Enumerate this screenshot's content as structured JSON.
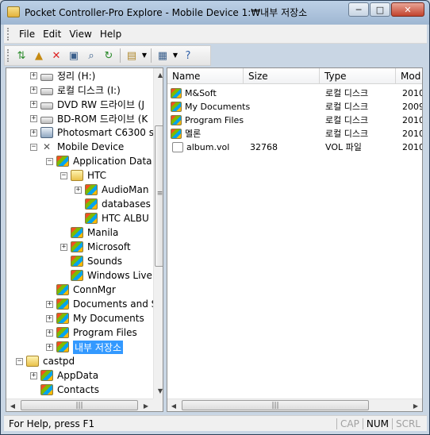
{
  "window": {
    "title": "Pocket Controller-Pro Explore - Mobile Device 1:₩내부 저장소",
    "min_label": "─",
    "max_label": "□",
    "close_label": "✕"
  },
  "menu": {
    "items": [
      "File",
      "Edit",
      "View",
      "Help"
    ]
  },
  "toolbar": {
    "icons": [
      "sync-icon",
      "folder-up-icon",
      "delete-icon",
      "properties-icon",
      "find-icon",
      "refresh-icon",
      "paste-icon",
      "view-icon",
      "help-icon"
    ]
  },
  "tree": {
    "items": [
      {
        "label": "정리 (H:)",
        "icon": "drive",
        "expander": "+"
      },
      {
        "label": "로컬 디스크 (I:)",
        "icon": "drive",
        "expander": "+"
      },
      {
        "label": "DVD RW 드라이브 (J",
        "icon": "drive",
        "expander": "+"
      },
      {
        "label": "BD-ROM 드라이브 (K",
        "icon": "drive",
        "expander": "+"
      },
      {
        "label": "Photosmart C6300 s",
        "icon": "printer",
        "expander": "+"
      },
      {
        "label": "Mobile Device",
        "icon": "device",
        "expander": "−"
      },
      {
        "label": "Application Data",
        "icon": "folder-win",
        "expander": "−"
      },
      {
        "label": "HTC",
        "icon": "folder-plain",
        "expander": "−"
      },
      {
        "label": "AudioMan",
        "icon": "folder-win",
        "expander": "+"
      },
      {
        "label": "databases",
        "icon": "folder-win",
        "expander": ""
      },
      {
        "label": "HTC ALBU",
        "icon": "folder-win",
        "expander": ""
      },
      {
        "label": "Manila",
        "icon": "folder-win",
        "expander": ""
      },
      {
        "label": "Microsoft",
        "icon": "folder-win",
        "expander": "+"
      },
      {
        "label": "Sounds",
        "icon": "folder-win",
        "expander": ""
      },
      {
        "label": "Windows Live",
        "icon": "folder-win",
        "expander": ""
      },
      {
        "label": "ConnMgr",
        "icon": "folder-win",
        "expander": ""
      },
      {
        "label": "Documents and S",
        "icon": "folder-win",
        "expander": "+"
      },
      {
        "label": "My Documents",
        "icon": "folder-win",
        "expander": "+"
      },
      {
        "label": "Program Files",
        "icon": "folder-win",
        "expander": "+"
      },
      {
        "label": "내부 저장소",
        "icon": "folder-win",
        "expander": "+",
        "selected": true
      },
      {
        "label": "castpd",
        "icon": "folder-plain",
        "expander": "−"
      },
      {
        "label": "AppData",
        "icon": "folder-win",
        "expander": "+"
      },
      {
        "label": "Contacts",
        "icon": "folder-win",
        "expander": ""
      }
    ]
  },
  "list": {
    "columns": [
      "Name",
      "Size",
      "Type",
      "Mod"
    ],
    "rows": [
      {
        "name": "M&Soft",
        "size": "",
        "type": "로컬 디스크",
        "mod": "2010",
        "icon": "folder-win"
      },
      {
        "name": "My Documents",
        "size": "",
        "type": "로컬 디스크",
        "mod": "2009",
        "icon": "folder-win"
      },
      {
        "name": "Program Files",
        "size": "",
        "type": "로컬 디스크",
        "mod": "2010",
        "icon": "folder-win"
      },
      {
        "name": "멜론",
        "size": "",
        "type": "로컬 디스크",
        "mod": "2010",
        "icon": "folder-win"
      },
      {
        "name": "album.vol",
        "size": "32768",
        "type": "VOL 파일",
        "mod": "2010",
        "icon": "file"
      }
    ]
  },
  "status": {
    "text": "For Help, press F1",
    "cap": "CAP",
    "num": "NUM",
    "scrl": "SCRL"
  },
  "scroll": {
    "grip": "≡",
    "hgrip": "|||",
    "up": "▲",
    "down": "▼",
    "left": "◀",
    "right": "▶"
  }
}
